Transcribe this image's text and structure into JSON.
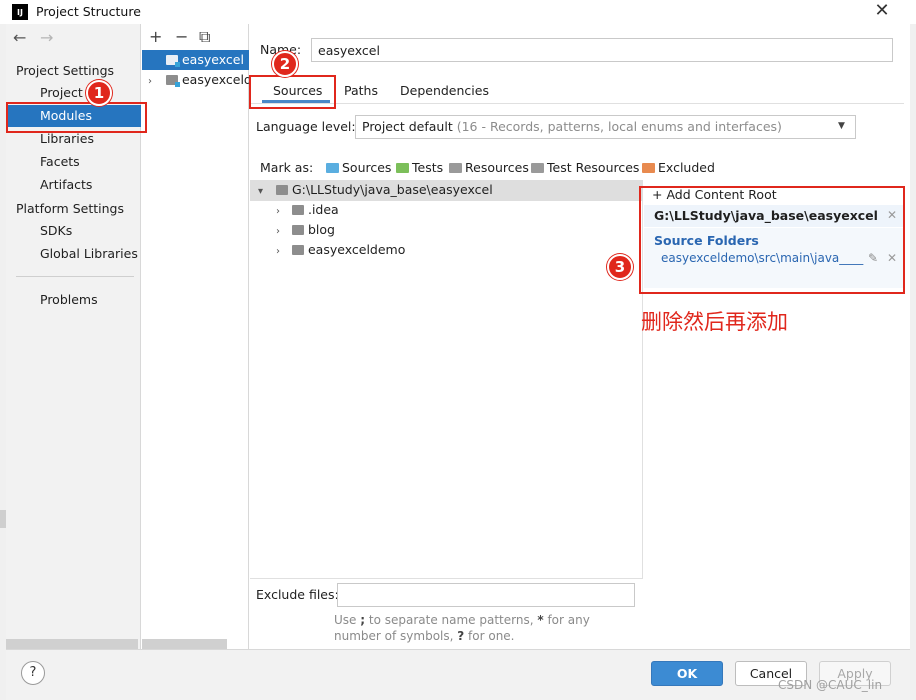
{
  "window": {
    "title": "Project Structure",
    "app_icon_text": "IJ",
    "close_glyph": "✕"
  },
  "nav": {
    "back_glyph": "←",
    "forward_glyph": "→"
  },
  "left_panel": {
    "section_project": "Project Settings",
    "section_platform": "Platform Settings",
    "items": {
      "project": "Project",
      "modules": "Modules",
      "libraries": "Libraries",
      "facets": "Facets",
      "artifacts": "Artifacts",
      "sdks": "SDKs",
      "global_libraries": "Global Libraries",
      "problems": "Problems"
    },
    "selected": "Modules"
  },
  "modules_toolbar": {
    "add_glyph": "+",
    "remove_glyph": "−",
    "copy_glyph": "⧉"
  },
  "modules": [
    {
      "label": "easyexcel",
      "selected": true
    },
    {
      "label": "easyexceldemo",
      "selected": false
    }
  ],
  "name_field": {
    "label": "Name:",
    "value": "easyexcel"
  },
  "tabs": [
    {
      "label": "Sources",
      "active": true
    },
    {
      "label": "Paths",
      "active": false
    },
    {
      "label": "Dependencies",
      "active": false
    }
  ],
  "language_level": {
    "label": "Language level:",
    "value_main": "Project default",
    "value_dim": " (16 - Records, patterns, local enums and interfaces)"
  },
  "mark_as": {
    "label": "Mark as:",
    "items": [
      {
        "label": "Sources",
        "color": "#5aaee0"
      },
      {
        "label": "Tests",
        "color": "#7cbf5a"
      },
      {
        "label": "Resources",
        "color": "#9a9a9a"
      },
      {
        "label": "Test Resources",
        "color": "#9a9a9a"
      },
      {
        "label": "Excluded",
        "color": "#e88a4f"
      }
    ]
  },
  "source_tree": {
    "root": "G:\\LLStudy\\java_base\\easyexcel",
    "children": [
      ".idea",
      "blog",
      "easyexceldemo"
    ]
  },
  "content_root": {
    "add_label": "+ Add Content Root",
    "path": "G:\\LLStudy\\java_base\\easyexcel",
    "source_folders_title": "Source Folders",
    "source_folder_path": "easyexceldemo\\src\\main\\java____",
    "remove_glyph": "✕",
    "edit_glyph": "✎"
  },
  "exclude_files": {
    "label": "Exclude files:",
    "value": "",
    "help_pre": "Use ",
    "help_sep1": ";",
    "help_mid": " to separate name patterns, ",
    "help_star": "*",
    "help_mid2": " for any number of symbols, ",
    "help_q": "?",
    "help_end": " for one."
  },
  "buttons": {
    "help": "?",
    "ok": "OK",
    "cancel": "Cancel",
    "apply": "Apply"
  },
  "annotations": {
    "badge1": "1",
    "badge2": "2",
    "badge3": "3",
    "note": "删除然后再添加",
    "color": "#e0271c"
  },
  "watermark": "CSDN @CAUC_lin"
}
